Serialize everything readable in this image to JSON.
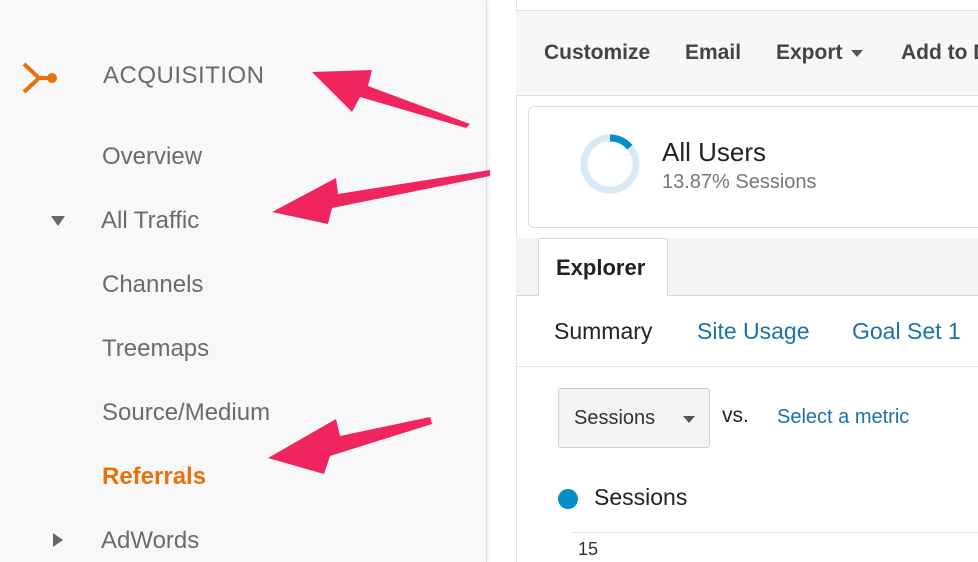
{
  "sidebar": {
    "section_label": "ACQUISITION",
    "section_icon": "acquisition-icon",
    "items": [
      {
        "label": "Overview"
      },
      {
        "label": "All Traffic",
        "expanded": true
      },
      {
        "label": "Channels"
      },
      {
        "label": "Treemaps"
      },
      {
        "label": "Source/Medium"
      },
      {
        "label": "Referrals",
        "active": true
      },
      {
        "label": "AdWords",
        "expanded": false
      }
    ]
  },
  "toolbar": {
    "customize": "Customize",
    "email": "Email",
    "export": "Export",
    "add_to": "Add to D"
  },
  "segment": {
    "title": "All Users",
    "subtitle": "13.87% Sessions",
    "percent": 13.87
  },
  "tabs": {
    "explorer": "Explorer"
  },
  "subtabs": {
    "summary": "Summary",
    "site_usage": "Site Usage",
    "goal_set": "Goal Set 1"
  },
  "metric": {
    "selected": "Sessions",
    "vs": "vs.",
    "select_metric": "Select a metric"
  },
  "chart": {
    "legend": "Sessions",
    "y_tick": "15"
  },
  "colors": {
    "accent_orange": "#e8710a",
    "link_blue": "#1a73a8",
    "series_blue": "#058dc7",
    "annotation_pink": "#f0245f"
  }
}
